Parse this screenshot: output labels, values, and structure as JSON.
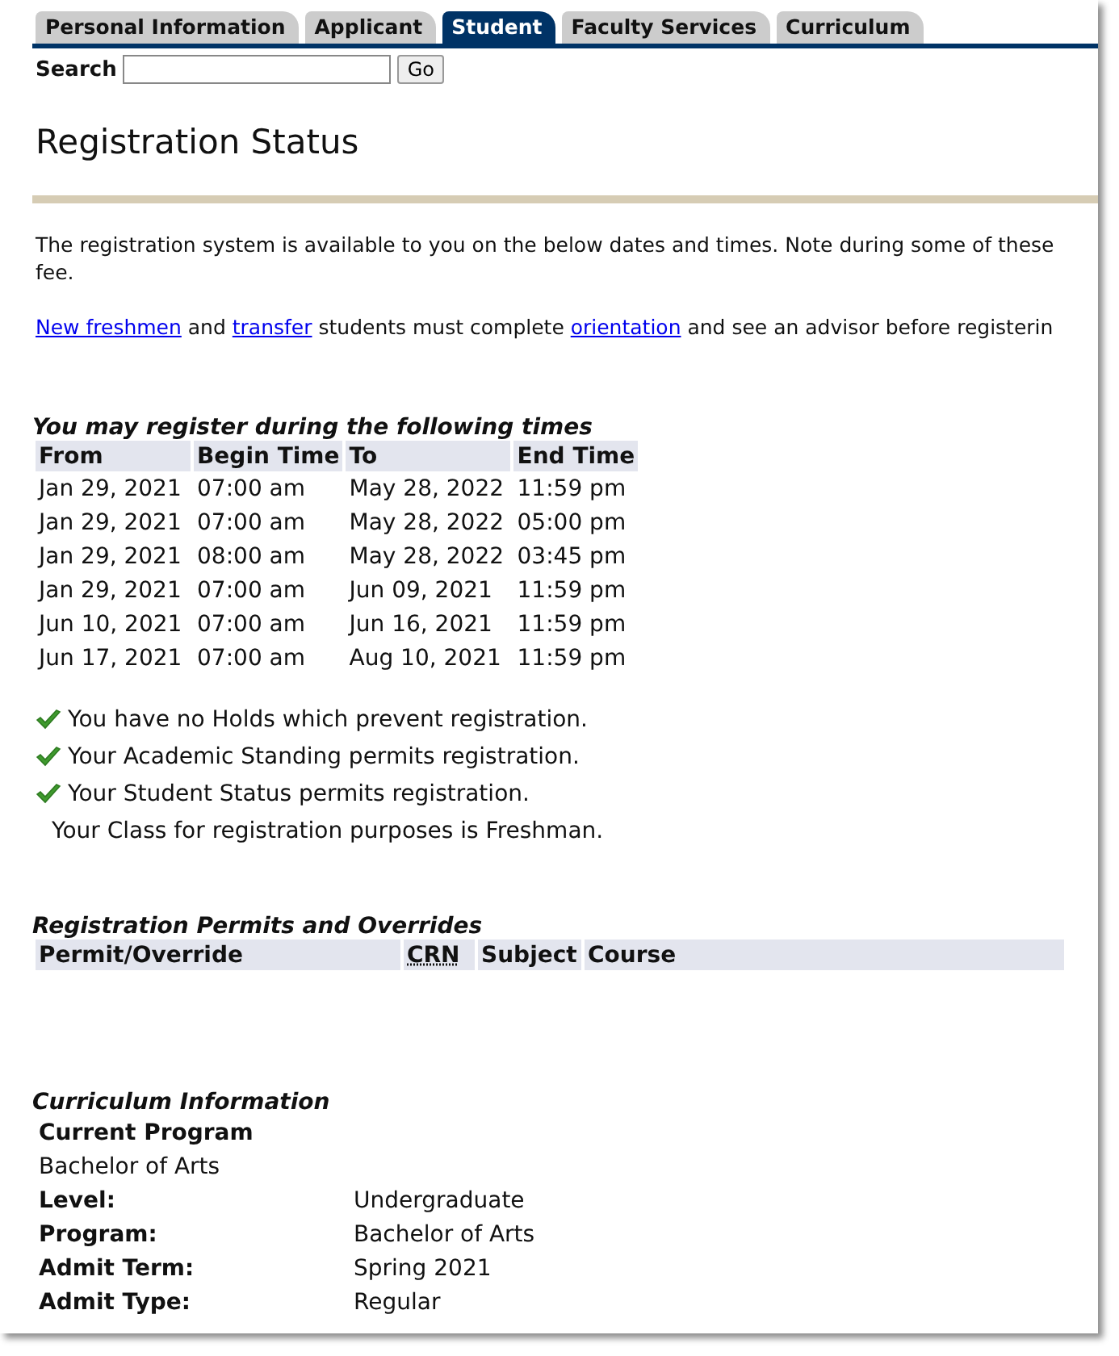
{
  "tabs": [
    {
      "label": "Personal Information",
      "selected": false
    },
    {
      "label": "Applicant",
      "selected": false
    },
    {
      "label": "Student",
      "selected": true
    },
    {
      "label": "Faculty Services",
      "selected": false
    },
    {
      "label": "Curriculum",
      "selected": false
    }
  ],
  "search": {
    "label": "Search",
    "button": "Go"
  },
  "title": "Registration Status",
  "intro": "The registration system is available to you on the below dates and times. Note during some of these",
  "intro_cont": "fee.",
  "notice": [
    {
      "kind": "link",
      "text": "New freshmen"
    },
    {
      "kind": "text",
      "text": " and "
    },
    {
      "kind": "link",
      "text": "transfer"
    },
    {
      "kind": "text",
      "text": " students must complete "
    },
    {
      "kind": "link",
      "text": "orientation"
    },
    {
      "kind": "text",
      "text": " and see an advisor before registerin"
    }
  ],
  "times": {
    "caption": "You may register during the following times",
    "columns": [
      "From",
      "Begin Time",
      "To",
      "End Time"
    ],
    "rows": [
      [
        "Jan 29, 2021",
        "07:00 am",
        "May 28, 2022",
        "11:59 pm"
      ],
      [
        "Jan 29, 2021",
        "07:00 am",
        "May 28, 2022",
        "05:00 pm"
      ],
      [
        "Jan 29, 2021",
        "08:00 am",
        "May 28, 2022",
        "03:45 pm"
      ],
      [
        "Jan 29, 2021",
        "07:00 am",
        "Jun 09, 2021",
        "11:59 pm"
      ],
      [
        "Jun 10, 2021",
        "07:00 am",
        "Jun 16, 2021",
        "11:59 pm"
      ],
      [
        "Jun 17, 2021",
        "07:00 am",
        "Aug 10, 2021",
        "11:59 pm"
      ]
    ]
  },
  "checks": [
    {
      "text": "You have no Holds which prevent registration.",
      "checked": true
    },
    {
      "text": "Your Academic Standing permits registration.",
      "checked": true
    },
    {
      "text": "Your Student Status permits registration.",
      "checked": true
    },
    {
      "text": "Your Class for registration purposes is Freshman.",
      "checked": false
    }
  ],
  "permits": {
    "caption": "Registration Permits and Overrides",
    "columns": [
      "Permit/Override",
      "CRN",
      "Subject",
      "Course"
    ]
  },
  "curriculum": {
    "caption": "Curriculum Information",
    "heading": "Current Program",
    "program": "Bachelor of Arts",
    "fields": [
      {
        "label": "Level:",
        "value": "Undergraduate"
      },
      {
        "label": "Program:",
        "value": "Bachelor of Arts"
      },
      {
        "label": "Admit Term:",
        "value": "Spring 2021"
      },
      {
        "label": "Admit Type:",
        "value": "Regular"
      }
    ]
  }
}
